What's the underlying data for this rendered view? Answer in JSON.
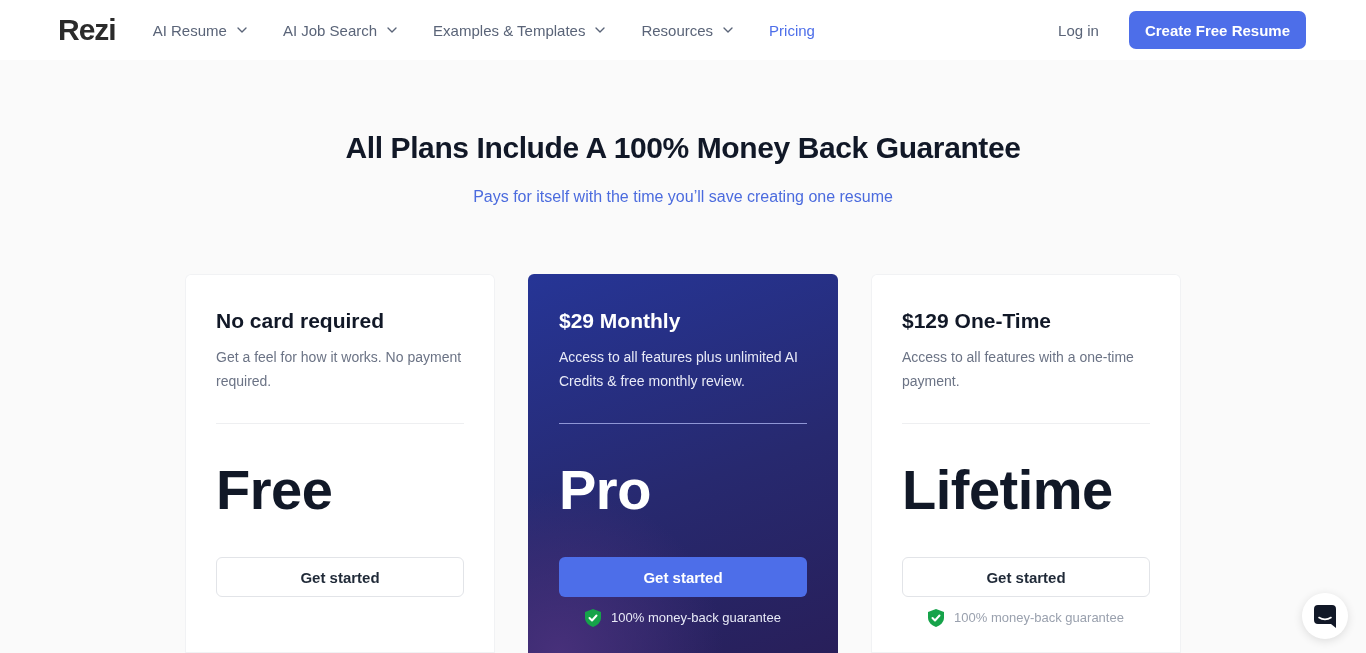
{
  "nav": {
    "logo": "Rezi",
    "links": [
      {
        "label": "AI Resume",
        "dropdown": true,
        "selected": false
      },
      {
        "label": "AI Job Search",
        "dropdown": true,
        "selected": false
      },
      {
        "label": "Examples & Templates",
        "dropdown": true,
        "selected": false
      },
      {
        "label": "Resources",
        "dropdown": true,
        "selected": false
      },
      {
        "label": "Pricing",
        "dropdown": false,
        "selected": true
      }
    ],
    "login": "Log in",
    "cta": "Create Free Resume"
  },
  "hero": {
    "title": "All Plans Include A 100% Money Back Guarantee",
    "subtitle": "Pays for itself with the time you’ll save creating one resume"
  },
  "plans": [
    {
      "title": "No card required",
      "description": "Get a feel for how it works. No payment required.",
      "name": "Free",
      "button": "Get started",
      "featured": false
    },
    {
      "title": "$29 Monthly",
      "description": "Access to all features plus unlimited AI Credits & free monthly review.",
      "name": "Pro",
      "button": "Get started",
      "featured": true,
      "guarantee": "100% money-back guarantee"
    },
    {
      "title": "$129 One-Time",
      "description": "Access to all features with a one-time payment.",
      "name": "Lifetime",
      "button": "Get started",
      "featured": false,
      "guarantee": "100% money-back guarantee"
    }
  ]
}
